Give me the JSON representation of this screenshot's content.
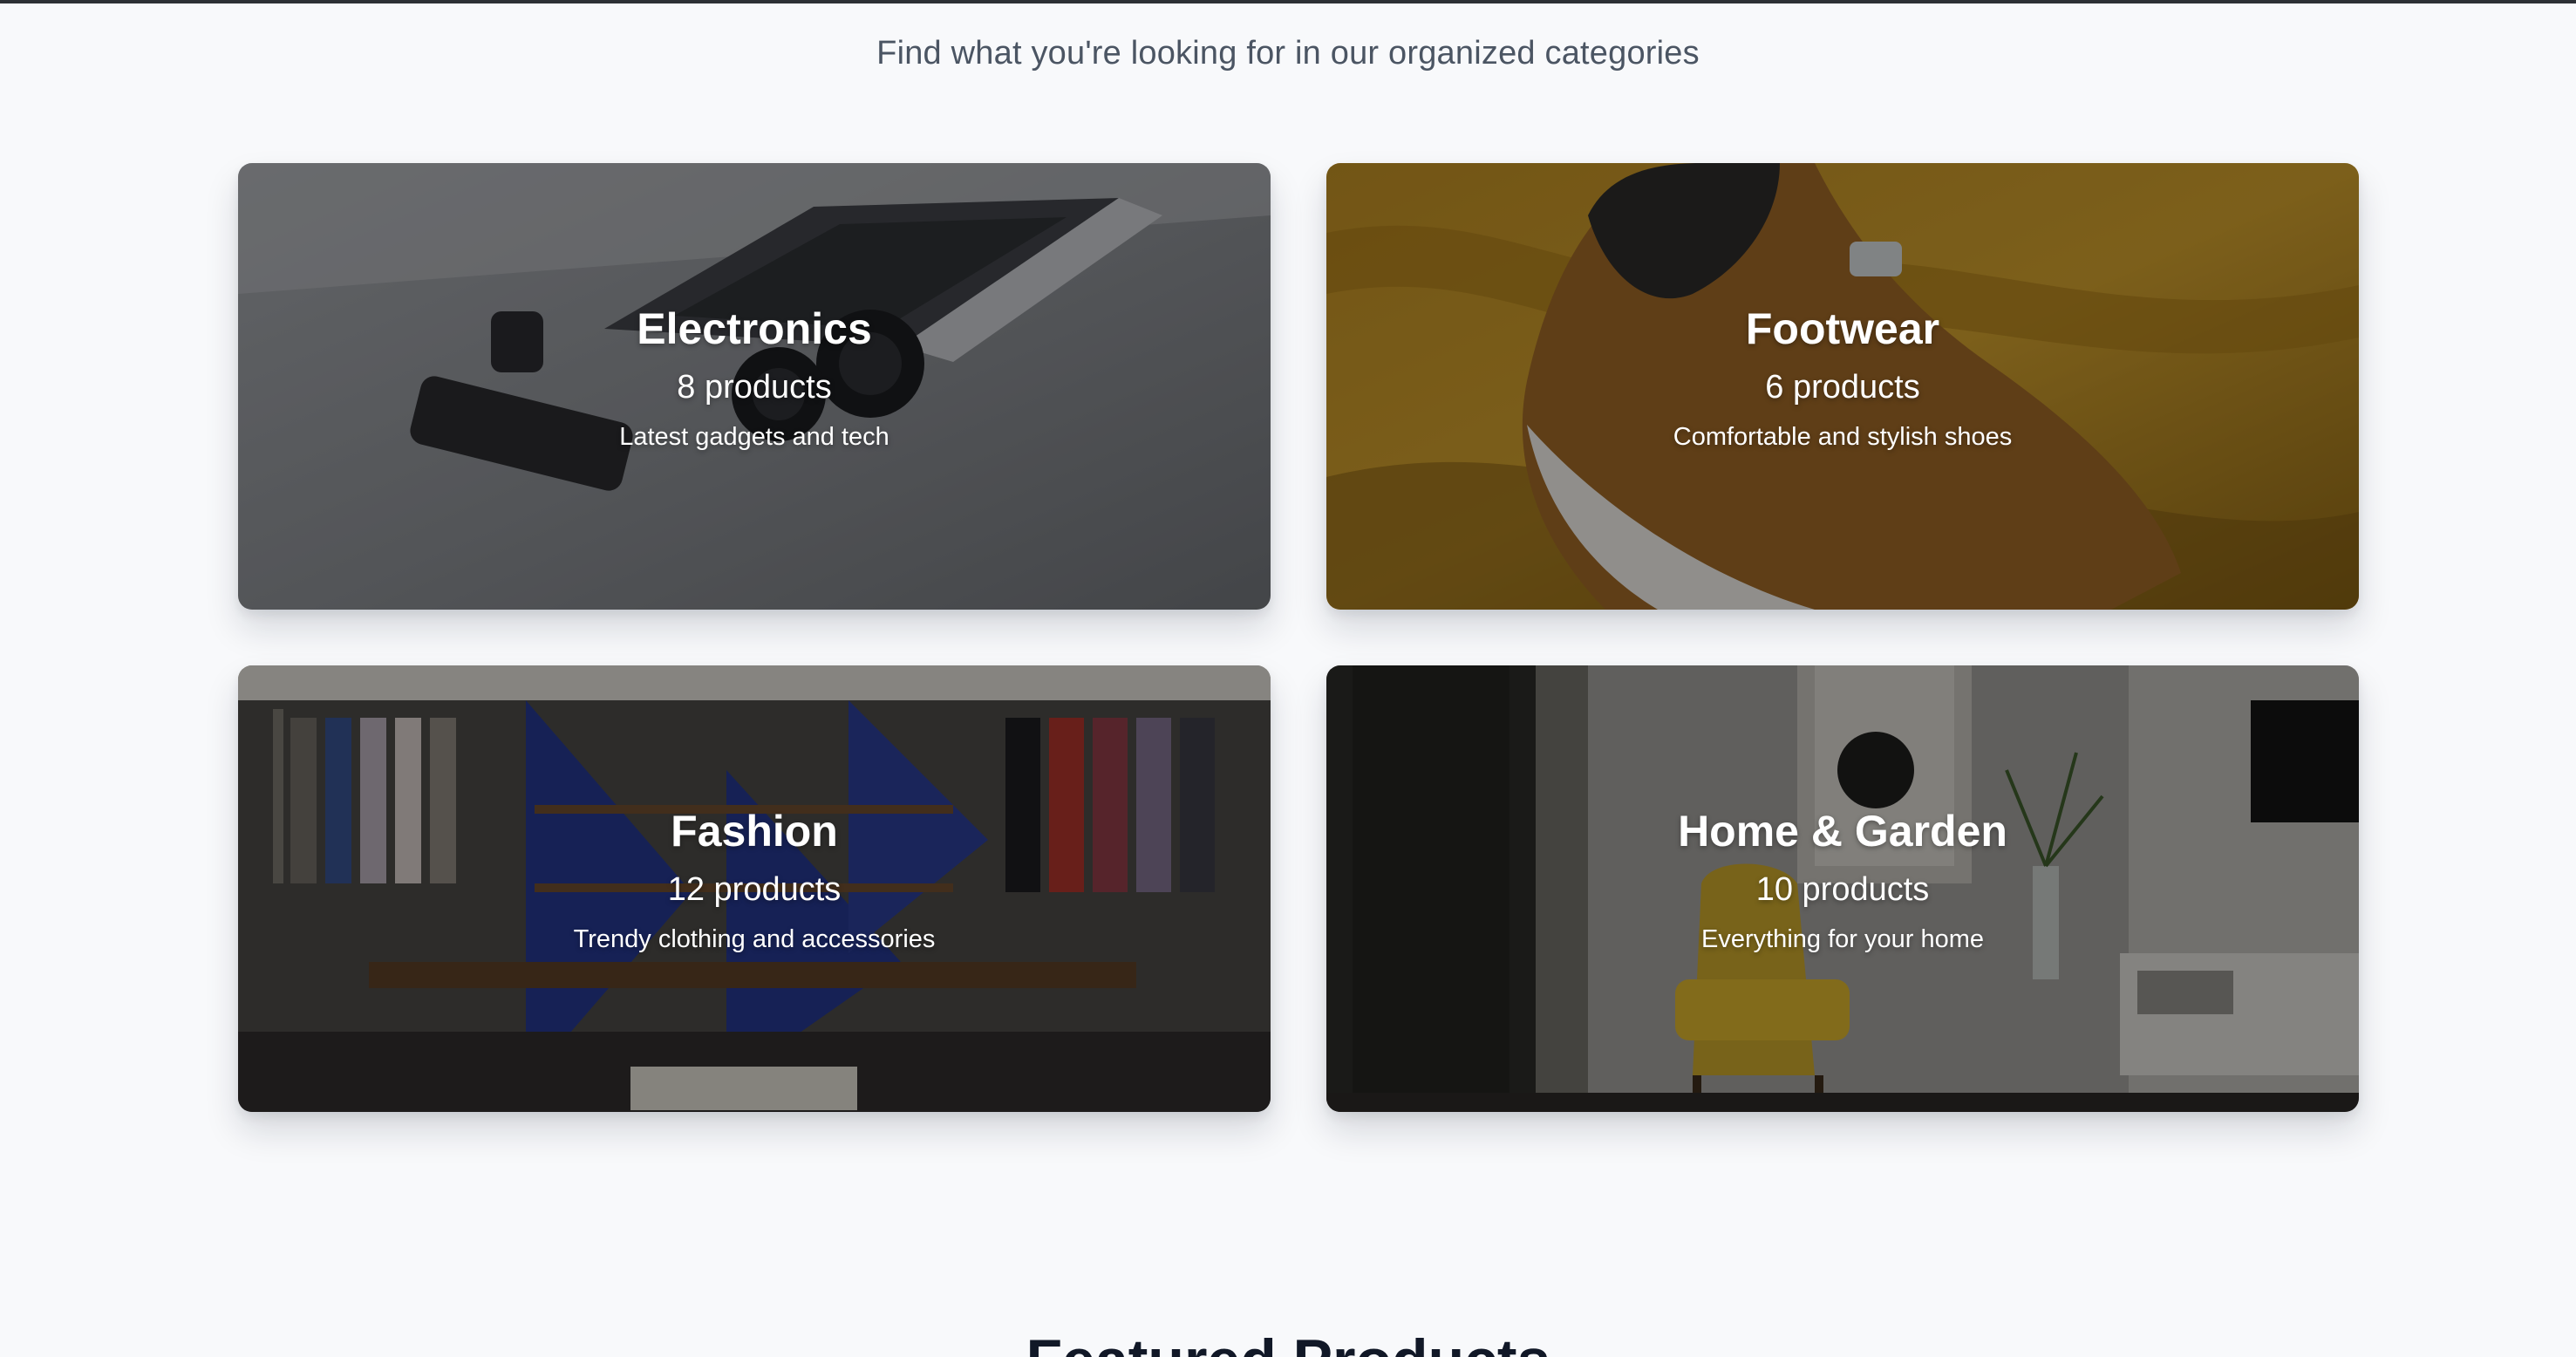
{
  "section": {
    "subtitle": "Find what you're looking for in our organized categories"
  },
  "categories": [
    {
      "name": "Electronics",
      "count": "8 products",
      "description": "Latest gadgets and tech",
      "image_icon": "electronics-photo-icon",
      "image_tone": "#8e9196"
    },
    {
      "name": "Footwear",
      "count": "6 products",
      "description": "Comfortable and stylish shoes",
      "image_icon": "footwear-photo-icon",
      "image_tone": "#9b6e1f"
    },
    {
      "name": "Fashion",
      "count": "12 products",
      "description": "Trendy clothing and accessories",
      "image_icon": "fashion-photo-icon",
      "image_tone": "#3a3a46"
    },
    {
      "name": "Home & Garden",
      "count": "10 products",
      "description": "Everything for your home",
      "image_icon": "home-garden-photo-icon",
      "image_tone": "#8a8a8a"
    }
  ],
  "featured": {
    "heading": "Featured Products"
  }
}
